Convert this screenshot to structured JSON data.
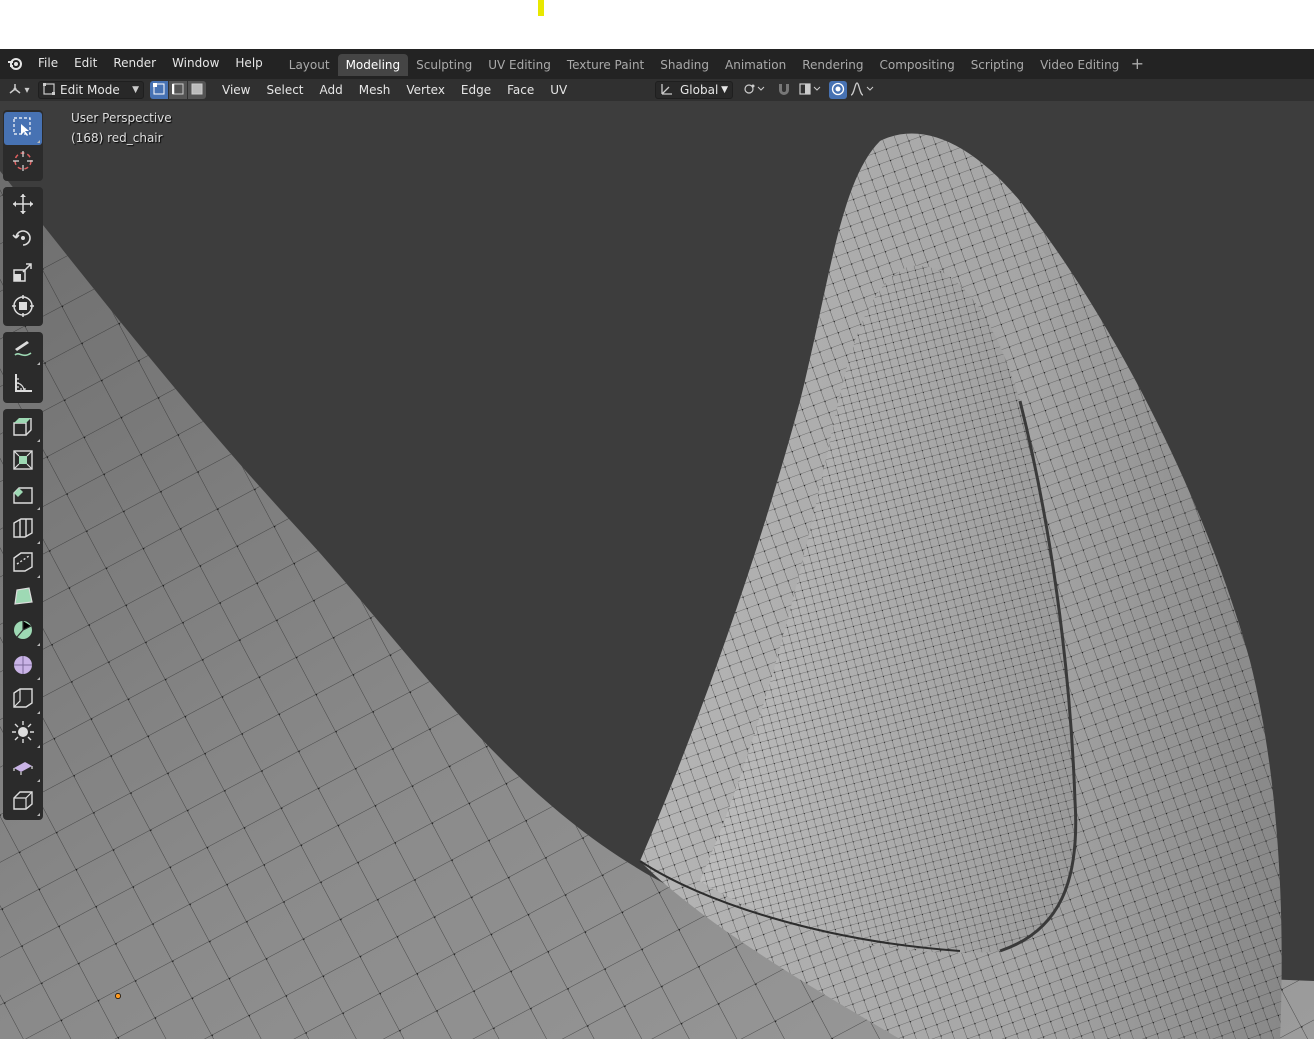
{
  "topbar": {
    "logo_icon": "blender-logo-icon",
    "menus": [
      "File",
      "Edit",
      "Render",
      "Window",
      "Help"
    ],
    "workspace_tabs": [
      {
        "label": "Layout",
        "active": false
      },
      {
        "label": "Modeling",
        "active": true
      },
      {
        "label": "Sculpting",
        "active": false
      },
      {
        "label": "UV Editing",
        "active": false
      },
      {
        "label": "Texture Paint",
        "active": false
      },
      {
        "label": "Shading",
        "active": false
      },
      {
        "label": "Animation",
        "active": false
      },
      {
        "label": "Rendering",
        "active": false
      },
      {
        "label": "Compositing",
        "active": false
      },
      {
        "label": "Scripting",
        "active": false
      },
      {
        "label": "Video Editing",
        "active": false
      }
    ],
    "add_workspace": "+"
  },
  "header": {
    "editor_type_icon": "3d-viewport-icon",
    "mode": "Edit Mode",
    "select_modes": [
      "vertex-select-icon",
      "edge-select-icon",
      "face-select-icon"
    ],
    "active_select_mode": "vertex",
    "menus": [
      "View",
      "Select",
      "Add",
      "Mesh",
      "Vertex",
      "Edge",
      "Face",
      "UV"
    ],
    "transform_orientation": "Global",
    "pivot_icon": "pivot-icon",
    "snap_icon": "snap-icon",
    "proportional_icon": "proportional-edit-icon",
    "falloff_icon": "falloff-curve-icon"
  },
  "viewport": {
    "view_name": "User Perspective",
    "object_info": "(168) red_chair",
    "background_color": "#3d3d3d",
    "mesh_color": "#8c8c8c"
  },
  "toolbar": {
    "groups": [
      [
        "select-box-icon",
        "cursor-icon"
      ],
      [
        "move-icon",
        "rotate-icon",
        "scale-icon",
        "transform-icon"
      ],
      [
        "annotate-icon",
        "measure-icon"
      ],
      [
        "extrude-region-icon",
        "inset-faces-icon",
        "bevel-icon",
        "loop-cut-icon",
        "knife-icon",
        "poly-build-icon",
        "spin-icon",
        "smooth-icon",
        "edge-slide-icon",
        "shrink-fatten-icon",
        "shear-icon",
        "rip-region-icon"
      ]
    ]
  },
  "colors": {
    "accent": "#4772b3",
    "topbar": "#232323",
    "header": "#303030",
    "toolbar": "#2b2b2b",
    "tool_icon_green": "#9ed9b4",
    "tool_icon_purple": "#c9b3e6"
  }
}
